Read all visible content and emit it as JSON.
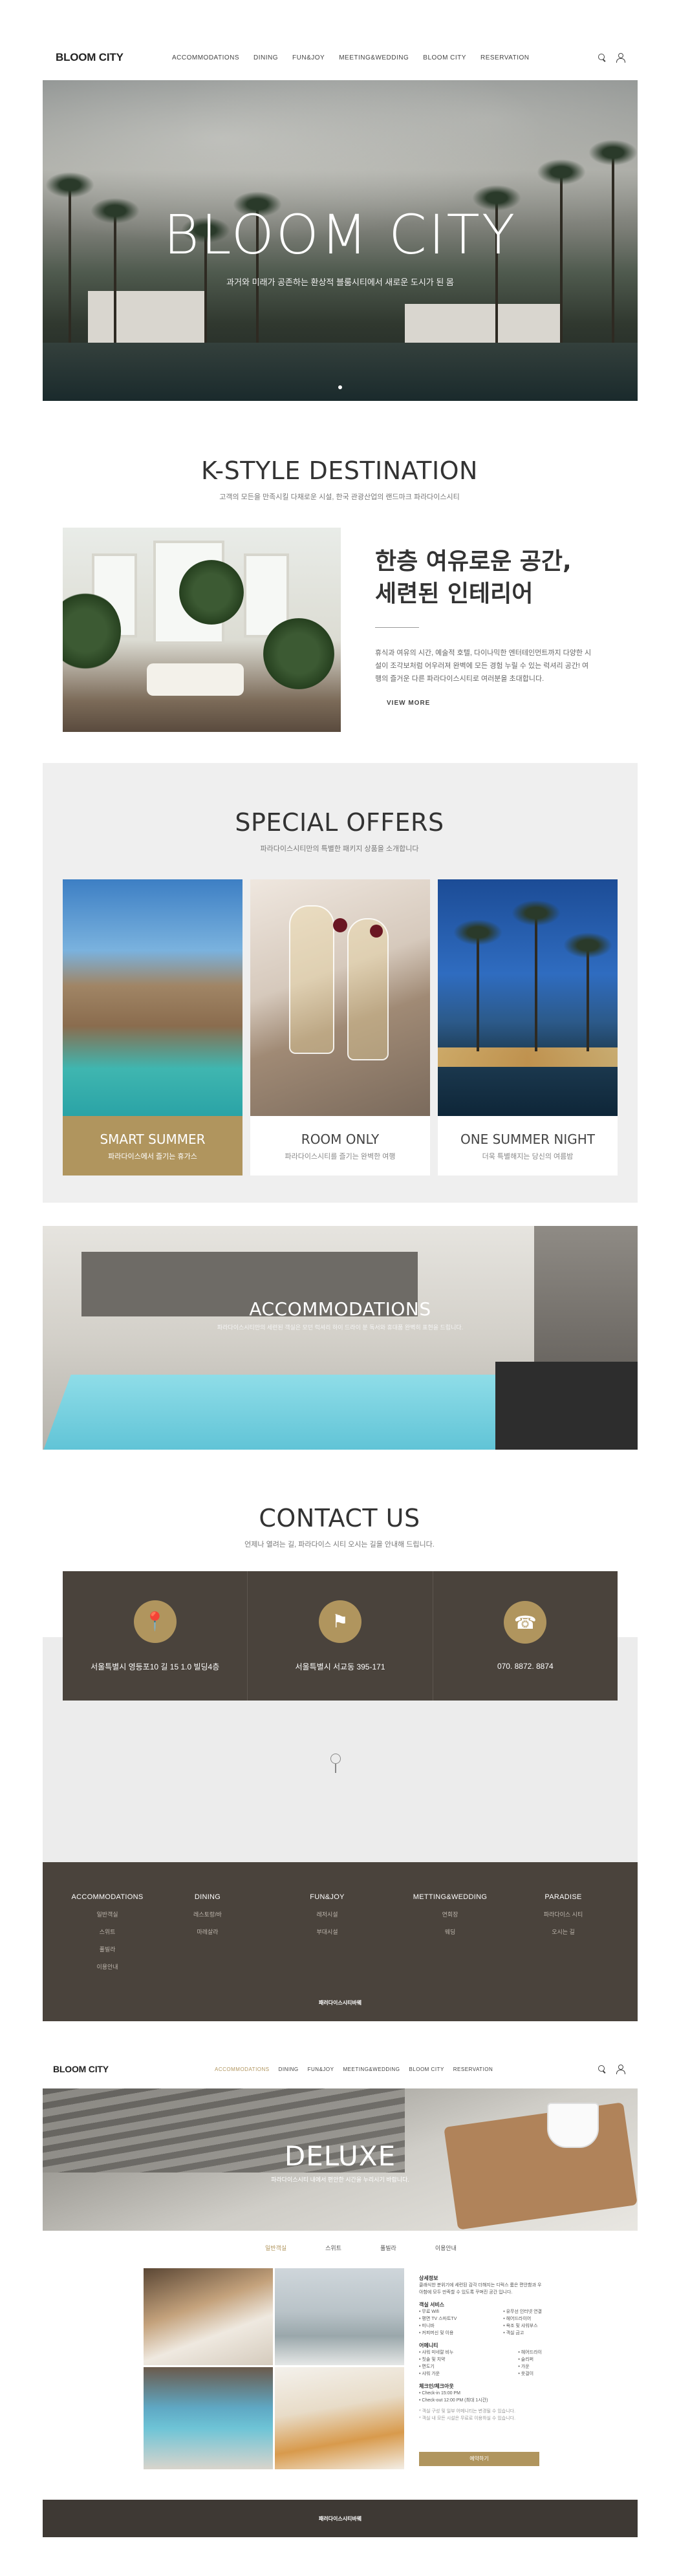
{
  "header": {
    "logo": "BLOOM CITY",
    "nav": [
      "ACCOMMODATIONS",
      "DINING",
      "FUN&JOY",
      "MEETING&WEDDING",
      "BLOOM CITY",
      "RESERVATION"
    ]
  },
  "hero": {
    "title": "BLOOM CITY",
    "subtitle": "과거와 미래가 공존하는 환상적 블룸시티에서 새로운 도시가 된 몸"
  },
  "kstyle": {
    "title": "K-STYLE DESTINATION",
    "subtitle": "고객의 모든을 만족시킬 다채로운 시설, 한국 관광산업의 랜드마크 파라다이스시티",
    "heading_line1": "한층 여유로운 공간,",
    "heading_line2": "세련된 인테리어",
    "body": "휴식과 여유의 시간, 예술적 호텔, 다이나믹한 엔터테인먼트까지 다양한 시설이 조각보처럼 어우러져 완벽에 모든 경험 누릴 수 있는 럭셔리 공간! 여행의 즐거운 다른 파라다이스시티로 여러분을 초대합니다.",
    "view_more": "VIEW MORE"
  },
  "offers": {
    "title": "SPECIAL OFFERS",
    "subtitle": "파라다이스시티만의 특별한 패키지 상품을 소개합니다",
    "cards": [
      {
        "title": "SMART SUMMER",
        "desc": "파라다이스에서 즐기는 휴가스"
      },
      {
        "title": "ROOM ONLY",
        "desc": "파라다이스시티를 즐기는 완벽한 여행"
      },
      {
        "title": "ONE SUMMER NIGHT",
        "desc": "더욱 특별해지는 당신의 여름밤"
      }
    ]
  },
  "accommodations": {
    "title": "ACCOMMODATIONS",
    "subtitle": "파라다이스시티만의 세련된 객실은 모던 럭셔리 하이 드라이 분 독서와 휴대품 완벽히 표현을 드립니다."
  },
  "contact": {
    "title": "CONTACT US",
    "subtitle": "언제나 열려는 길, 파라다이스 시티 오시는 길을 안내해 드립니다.",
    "items": [
      {
        "icon": "📍",
        "text": "서울특별시 영등포10 길 15 1.0 빌딩4층"
      },
      {
        "icon": "⚑",
        "text": "서울특별시 서교동 395-171"
      },
      {
        "icon": "☎",
        "text": "070. 8872. 8874"
      }
    ]
  },
  "footer": {
    "columns": [
      {
        "heading": "ACCOMMODATIONS",
        "items": [
          "일반객실",
          "스위트",
          "풀빌라",
          "이용안내"
        ]
      },
      {
        "heading": "DINING",
        "items": [
          "레스토랑/바",
          "마레살라"
        ]
      },
      {
        "heading": "FUN&JOY",
        "items": [
          "레저시설",
          "부대시설"
        ]
      },
      {
        "heading": "METTING&WEDDING",
        "items": [
          "연회장",
          "웨딩"
        ]
      },
      {
        "heading": "PARADISE",
        "items": [
          "파라다이스 시티",
          "오시는 길"
        ]
      }
    ],
    "copyright": "패러다이스시티바웨"
  },
  "page2": {
    "header": {
      "logo": "BLOOM CITY",
      "nav": [
        "ACCOMMODATIONS",
        "DINING",
        "FUN&JOY",
        "MEETING&WEDDING",
        "BLOOM CITY",
        "RESERVATION"
      ],
      "active_nav": "ACCOMMODATIONS"
    },
    "banner": {
      "title": "DELUXE",
      "subtitle": "파라다이스시티 내에서 편안한 시간을 누리시기 바랍니다."
    },
    "tabs": [
      "일반객실",
      "스위트",
      "풀빌라",
      "이용안내"
    ],
    "active_tab": "일반객실",
    "info": {
      "h1": "상세정보",
      "p1": "클래식한 분위기에 세련된 감각 더해지는 디럭스 룸은 편안함과 우아함에 모두 만족할 수 있도록 꾸며진 공간 입니다.",
      "h2": "객실 서비스",
      "services_left": [
        "• 무료 Wifi",
        "• 평면 TV 스마트TV",
        "• 미니바",
        "• 커피머신 및 이용"
      ],
      "services_right": [
        "• 유무선 인터넷 연결",
        "• 헤어드라이어",
        "• 욕조 및 샤워부스",
        "• 객실 금고"
      ],
      "h3": "어메니티",
      "amen_left": [
        "• 샤워 미네랄 비누",
        "• 칫솔 및 치약",
        "• 면도기",
        "• 샤워 가운"
      ],
      "amen_right": [
        "• 헤어드라이",
        "• 슬리퍼",
        "• 가운",
        "• 옷걸이"
      ],
      "h4": "체크인/체크아웃",
      "checkin": [
        "• Check-in 15:00 PM",
        "• Check-out 12:00 PM (최대 1시간)"
      ],
      "notes": [
        "* 객실 구성 및 일부 어메니티는 변경될 수 있습니다.",
        "* 객실 내 모든 시설은 무료로 이용하실 수 있습니다."
      ],
      "book": "예약하기"
    },
    "copyright": "패러다이스시티바웨"
  },
  "colors": {
    "accent_gold": "#b0955e",
    "dark_brown": "#4a433c",
    "light_gray": "#efefef"
  }
}
